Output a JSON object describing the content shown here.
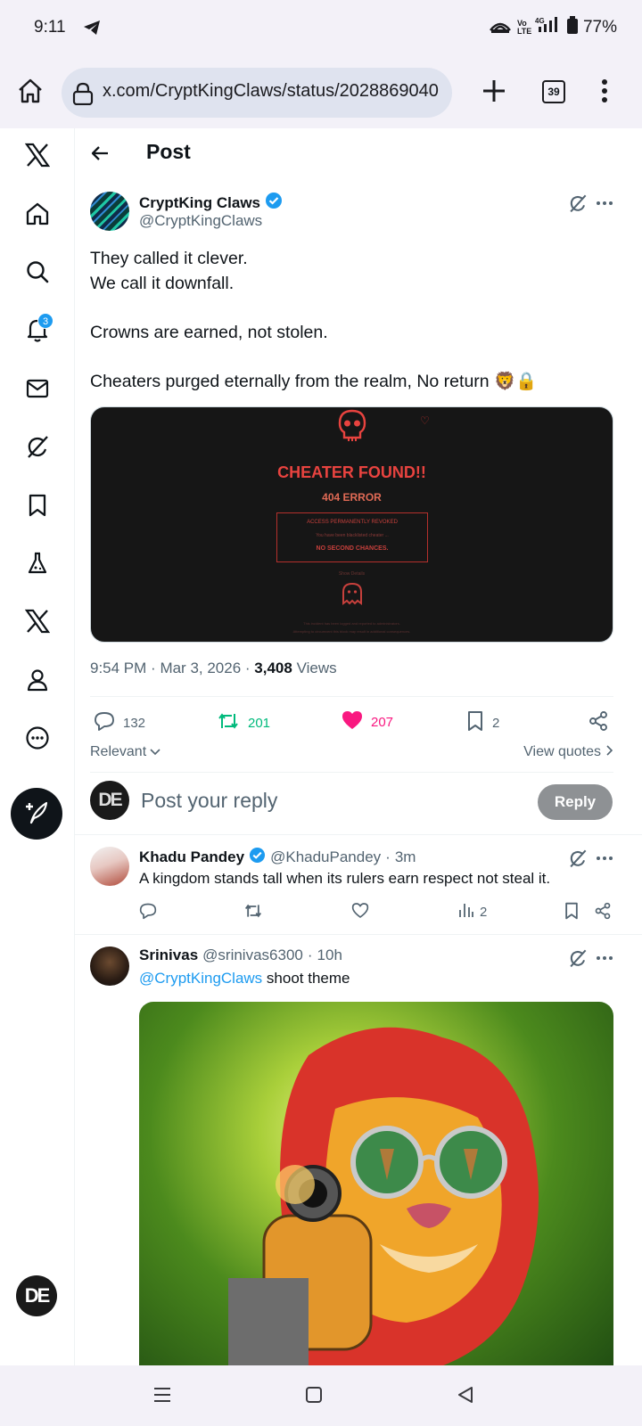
{
  "status": {
    "time": "9:11",
    "battery": "77%",
    "network": "4G",
    "volte": "Vo LTE"
  },
  "browser": {
    "url": "x.com/CryptKingClaws/status/2028869040",
    "tab_count": "39"
  },
  "rail": {
    "notification_badge": "3",
    "avatar_text": "DE"
  },
  "header": {
    "title": "Post"
  },
  "tweet": {
    "author_name": "CryptKing Claws",
    "author_handle": "@CryptKingClaws",
    "lines": [
      "They called it clever.",
      "We call it downfall.",
      "",
      "Crowns are earned, not stolen.",
      "",
      "Cheaters purged eternally from the realm, No return 🦁🔒"
    ],
    "media": {
      "headline": "CHEATER FOUND!!",
      "subhead": "404 ERROR",
      "box_title": "ACCESS PERMANENTLY REVOKED",
      "box_line": "You have been blacklisted cheater ...",
      "box_footer": "NO SECOND CHANCES.",
      "show_details": "Show Details",
      "footnote1": "This incident has been logged and reported to administrators.",
      "footnote2": "Attempting to circumvent this block may result in additional consequences."
    },
    "time": "9:54 PM",
    "date": "Mar 3, 2026",
    "views_count": "3,408",
    "views_label": "Views",
    "replies": "132",
    "reposts": "201",
    "likes": "207",
    "bookmarks": "2"
  },
  "sort": {
    "relevant": "Relevant",
    "view_quotes": "View quotes"
  },
  "composer": {
    "placeholder": "Post your reply",
    "reply_button": "Reply",
    "avatar_text": "DE"
  },
  "replies": [
    {
      "name": "Khadu Pandey",
      "handle": "@KhaduPandey",
      "age": "3m",
      "text": "A kingdom stands tall when its rulers earn respect not steal it.",
      "views": "2"
    },
    {
      "name": "Srinivas",
      "handle": "@srinivas6300",
      "age": "10h",
      "mention": "@CryptKingClaws",
      "text": "shoot theme"
    }
  ],
  "colors": {
    "accent": "#1d9bf0",
    "repost": "#00ba7c",
    "like": "#f91880",
    "text": "#0f1419",
    "muted": "#536471"
  },
  "icons": [
    "home-icon",
    "search-icon",
    "bell-icon",
    "mail-icon",
    "grok-icon",
    "bookmark-icon",
    "flask-icon",
    "x-logo-icon",
    "person-icon",
    "more-icon",
    "compose-icon"
  ]
}
